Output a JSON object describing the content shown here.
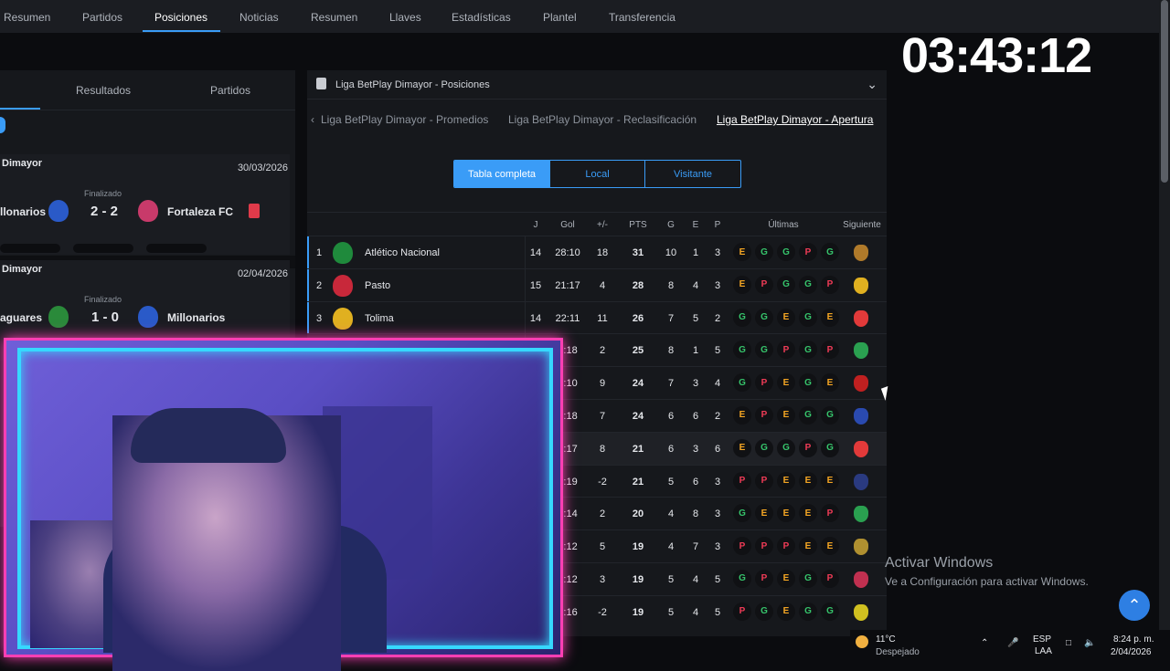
{
  "top_tabs": [
    "Resumen",
    "Partidos",
    "Posiciones",
    "Noticias",
    "Resumen",
    "Llaves",
    "Estadísticas",
    "Plantel",
    "Transferencia"
  ],
  "timer": "03:43:12",
  "left_panel": {
    "tabs": [
      "Resultados",
      "Partidos"
    ],
    "matches": [
      {
        "league": "Dimayor",
        "date": "30/03/2026",
        "status": "Finalizado",
        "home": "llonarios",
        "score": "2 - 2",
        "away": "Fortaleza FC"
      },
      {
        "league": "Dimayor",
        "date": "02/04/2026",
        "status": "Finalizado",
        "home": "aguares",
        "score": "1 - 0",
        "away": "Millonarios"
      }
    ]
  },
  "standings": {
    "title": "Liga BetPlay Dimayor - Posiciones",
    "crumbs": [
      "Liga BetPlay Dimayor - Promedios",
      "Liga BetPlay Dimayor - Reclasificación",
      "Liga BetPlay Dimayor - Apertura"
    ],
    "segments": [
      "Tabla completa",
      "Local",
      "Visitante"
    ],
    "headers": {
      "j": "J",
      "gol": "Gol",
      "diff": "+/-",
      "pts": "PTS",
      "g": "G",
      "e": "E",
      "p": "P",
      "ultimas": "Últimas",
      "siguiente": "Siguiente"
    },
    "rows": [
      {
        "pos": "1",
        "name": "Atlético Nacional",
        "j": "14",
        "gol": "28:10",
        "diff": "18",
        "pts": "31",
        "g": "10",
        "e": "1",
        "p": "3",
        "form": [
          "E",
          "G",
          "G",
          "P",
          "G"
        ],
        "crest": "#1f8a3c",
        "next": "#b07a2a"
      },
      {
        "pos": "2",
        "name": "Pasto",
        "j": "15",
        "gol": "21:17",
        "diff": "4",
        "pts": "28",
        "g": "8",
        "e": "4",
        "p": "3",
        "form": [
          "E",
          "P",
          "G",
          "G",
          "P"
        ],
        "crest": "#c8283a",
        "next": "#e0b020"
      },
      {
        "pos": "3",
        "name": "Tolima",
        "j": "14",
        "gol": "22:11",
        "diff": "11",
        "pts": "26",
        "g": "7",
        "e": "5",
        "p": "2",
        "form": [
          "G",
          "G",
          "E",
          "G",
          "E"
        ],
        "crest": "#e0b020",
        "next": "#e23a3a"
      },
      {
        "pos": "",
        "name": "",
        "j": "",
        "gol": "0:18",
        "diff": "2",
        "pts": "25",
        "g": "8",
        "e": "1",
        "p": "5",
        "form": [
          "G",
          "G",
          "P",
          "G",
          "P"
        ],
        "crest": "",
        "next": "#2aa050"
      },
      {
        "pos": "",
        "name": "",
        "j": "",
        "gol": "9:10",
        "diff": "9",
        "pts": "24",
        "g": "7",
        "e": "3",
        "p": "4",
        "form": [
          "G",
          "P",
          "E",
          "G",
          "E"
        ],
        "crest": "",
        "next": "#c02020"
      },
      {
        "pos": "",
        "name": "",
        "j": "",
        "gol": "5:18",
        "diff": "7",
        "pts": "24",
        "g": "6",
        "e": "6",
        "p": "2",
        "form": [
          "E",
          "P",
          "E",
          "G",
          "G"
        ],
        "crest": "",
        "next": "#2a4ab0"
      },
      {
        "pos": "",
        "name": "",
        "j": "",
        "gol": "5:17",
        "diff": "8",
        "pts": "21",
        "g": "6",
        "e": "3",
        "p": "6",
        "form": [
          "E",
          "G",
          "G",
          "P",
          "G"
        ],
        "crest": "",
        "next": "#e23a3a"
      },
      {
        "pos": "",
        "name": "",
        "j": "",
        "gol": "7:19",
        "diff": "-2",
        "pts": "21",
        "g": "5",
        "e": "6",
        "p": "3",
        "form": [
          "P",
          "P",
          "E",
          "E",
          "E"
        ],
        "crest": "",
        "next": "#2a3a80"
      },
      {
        "pos": "",
        "name": "",
        "j": "",
        "gol": "5:14",
        "diff": "2",
        "pts": "20",
        "g": "4",
        "e": "8",
        "p": "3",
        "form": [
          "G",
          "E",
          "E",
          "E",
          "P"
        ],
        "crest": "",
        "next": "#2aa050"
      },
      {
        "pos": "",
        "name": "",
        "j": "",
        "gol": "7:12",
        "diff": "5",
        "pts": "19",
        "g": "4",
        "e": "7",
        "p": "3",
        "form": [
          "P",
          "P",
          "P",
          "E",
          "E"
        ],
        "crest": "",
        "next": "#b09030"
      },
      {
        "pos": "",
        "name": "",
        "j": "",
        "gol": "5:12",
        "diff": "3",
        "pts": "19",
        "g": "5",
        "e": "4",
        "p": "5",
        "form": [
          "G",
          "P",
          "E",
          "G",
          "P"
        ],
        "crest": "",
        "next": "#c03050"
      },
      {
        "pos": "",
        "name": "",
        "j": "",
        "gol": "6:16",
        "diff": "-2",
        "pts": "19",
        "g": "5",
        "e": "4",
        "p": "5",
        "form": [
          "P",
          "G",
          "E",
          "G",
          "G"
        ],
        "crest": "",
        "next": "#d0c020"
      }
    ]
  },
  "windows": {
    "activate_title": "Activar Windows",
    "activate_sub": "Ve a Configuración para activar Windows."
  },
  "taskbar": {
    "temp": "11°C",
    "weather": "Despejado",
    "lang": "ESP",
    "layout": "LAA",
    "time": "8:24 p. m.",
    "date": "2/04/2026"
  },
  "colors": {
    "accent": "#3a9cf7",
    "win": "#36c46b",
    "draw": "#f5a623",
    "loss": "#ef3b56"
  }
}
